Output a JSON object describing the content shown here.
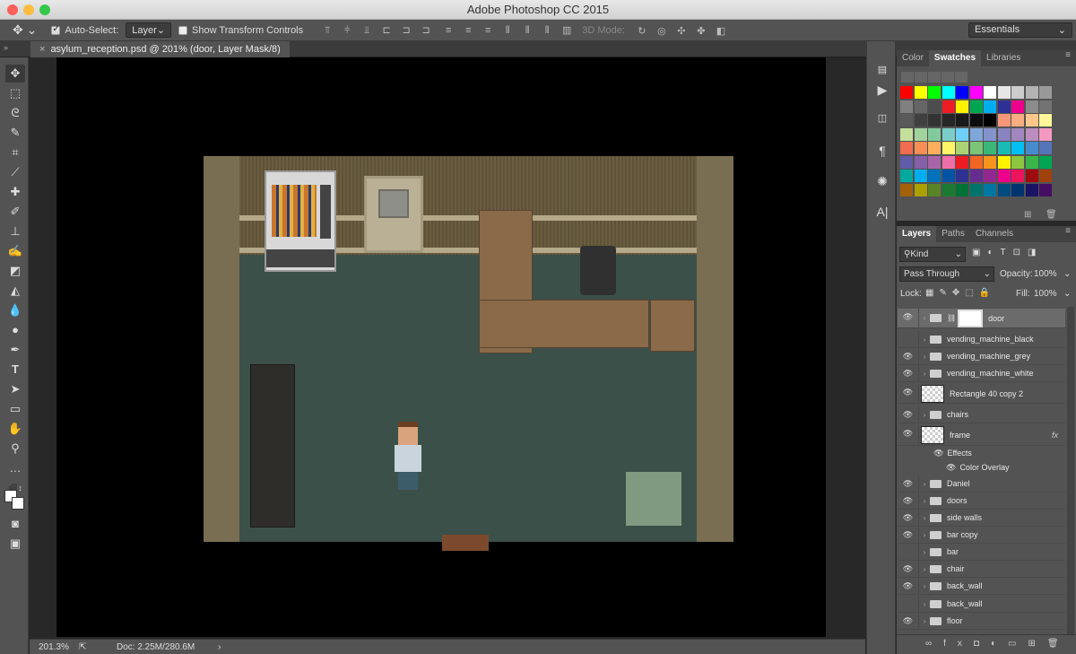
{
  "window": {
    "title": "Adobe Photoshop CC 2015"
  },
  "options": {
    "auto_select_label": "Auto-Select:",
    "auto_select_value": "Layer",
    "transform_label": "Show Transform Controls",
    "mode_label": "3D Mode:",
    "workspace": "Essentials"
  },
  "document": {
    "tab": "asylum_reception.psd @ 201% (door, Layer Mask/8)"
  },
  "status": {
    "zoom": "201.3%",
    "doc": "Doc: 2.25M/280.6M"
  },
  "color_panel": {
    "tabs": [
      "Color",
      "Swatches",
      "Libraries"
    ]
  },
  "layers_panel": {
    "tabs": [
      "Layers",
      "Paths",
      "Channels"
    ],
    "filter": "Kind",
    "blend": "Pass Through",
    "opacity_label": "Opacity:",
    "opacity": "100%",
    "lock_label": "Lock:",
    "fill_label": "Fill:",
    "fill": "100%",
    "layers": [
      {
        "name": "door",
        "visible": true,
        "type": "folder",
        "selected": true
      },
      {
        "name": "vending_machine_black",
        "visible": false,
        "type": "folder"
      },
      {
        "name": "vending_machine_grey",
        "visible": true,
        "type": "folder"
      },
      {
        "name": "vending_machine_white",
        "visible": true,
        "type": "folder"
      },
      {
        "name": "Rectangle 40 copy 2",
        "visible": true,
        "type": "layer"
      },
      {
        "name": "chairs",
        "visible": true,
        "type": "folder"
      },
      {
        "name": "frame",
        "visible": true,
        "type": "layer",
        "fx": "fx"
      },
      {
        "name": "Effects",
        "visible": true,
        "type": "effects"
      },
      {
        "name": "Color Overlay",
        "visible": true,
        "type": "effect"
      },
      {
        "name": "Daniel",
        "visible": true,
        "type": "folder"
      },
      {
        "name": "doors",
        "visible": true,
        "type": "folder"
      },
      {
        "name": "side walls",
        "visible": true,
        "type": "folder"
      },
      {
        "name": "bar copy",
        "visible": true,
        "type": "folder"
      },
      {
        "name": "bar",
        "visible": false,
        "type": "folder"
      },
      {
        "name": "chair",
        "visible": true,
        "type": "folder"
      },
      {
        "name": "back_wall",
        "visible": true,
        "type": "folder"
      },
      {
        "name": "back_wall",
        "visible": false,
        "type": "folder"
      },
      {
        "name": "floor",
        "visible": true,
        "type": "folder"
      }
    ]
  },
  "colors": {
    "swatch_rows": [
      [
        "#ff0000",
        "#ffff00",
        "#00ff00",
        "#00ffff",
        "#0000ff",
        "#ff00ff",
        "#ffffff",
        "#e6e6e6",
        "#cccccc",
        "#b3b3b3",
        "#999999"
      ],
      [
        "#808080",
        "#666666",
        "#4d4d4d",
        "#ee1c24",
        "#fff200",
        "#00a651",
        "#00aeef",
        "#2e3192",
        "#ec008c",
        "#8c8c8c",
        "#737373"
      ],
      [
        "#5a5a5a",
        "#404040",
        "#333333",
        "#262626",
        "#1a1a1a",
        "#0d0d0d",
        "#000000",
        "#f7977a",
        "#f9ad81",
        "#fdc68a",
        "#fff79a"
      ],
      [
        "#c4df9b",
        "#a3d39c",
        "#82ca9d",
        "#7bcdc8",
        "#6ecff6",
        "#7ea7d8",
        "#8493ca",
        "#8882be",
        "#a187be",
        "#bc8dbf",
        "#f49ac2"
      ],
      [
        "#f26c4f",
        "#f68e56",
        "#fbaf5d",
        "#fff568",
        "#acd373",
        "#7cc576",
        "#3bb878",
        "#1abbb4",
        "#00bff3",
        "#448ccb",
        "#5574b9"
      ],
      [
        "#605ca8",
        "#855fa8",
        "#a864a8",
        "#f06eaa",
        "#ed1c24",
        "#f26522",
        "#f7941d",
        "#fff200",
        "#8dc63f",
        "#39b54a",
        "#00a651"
      ],
      [
        "#00a99d",
        "#00aeef",
        "#0072bc",
        "#0054a6",
        "#2e3192",
        "#662d91",
        "#92278f",
        "#ec008c",
        "#ed145b",
        "#9e0b0f",
        "#a0410d"
      ],
      [
        "#a36209",
        "#aba000",
        "#598527",
        "#1a7b30",
        "#007236",
        "#00746b",
        "#0076a3",
        "#004b80",
        "#003471",
        "#1b1464",
        "#440e62"
      ]
    ]
  }
}
